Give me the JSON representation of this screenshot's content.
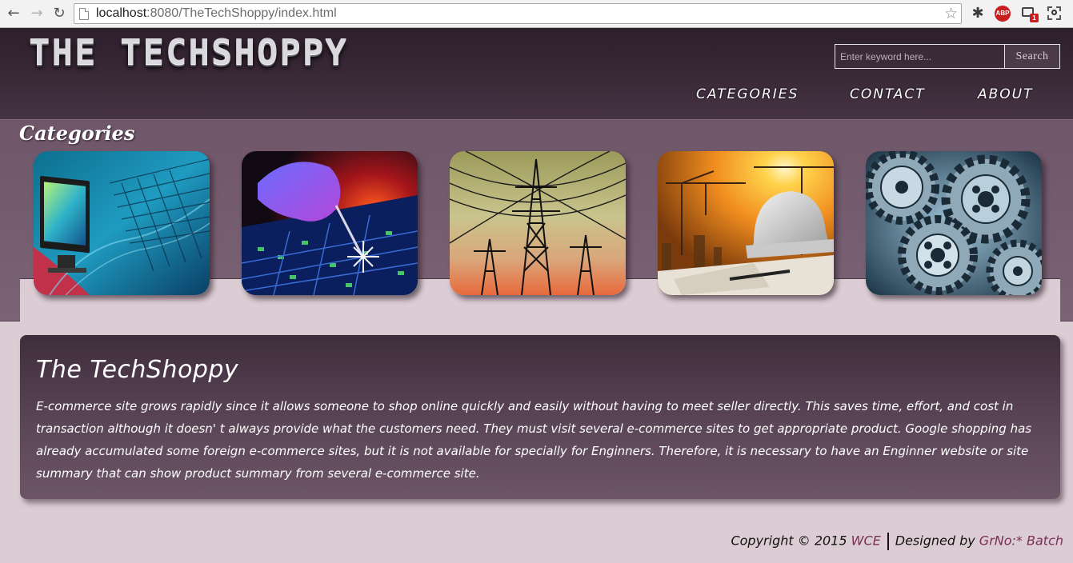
{
  "browser": {
    "url_host": "localhost",
    "url_rest": ":8080/TheTechShoppy/index.html",
    "icons": [
      "back-icon",
      "forward-icon",
      "reload-icon",
      "page-icon",
      "bookmark-star-icon",
      "bug-extension-icon",
      "adblock-icon",
      "cast-extension-icon",
      "screenshot-extension-icon"
    ],
    "abp_label": "ABP",
    "cast_badge": "1"
  },
  "header": {
    "logo": "THE TECHSHOPPY",
    "search": {
      "placeholder": "Enter keyword here...",
      "button_label": "Search"
    },
    "nav": [
      "CATEGORIES",
      "CONTACT",
      "ABOUT"
    ]
  },
  "categories": {
    "title": "Categories",
    "tiles": [
      {
        "image": "computer-monitor-keyboard"
      },
      {
        "image": "circuit-board-probe"
      },
      {
        "image": "electricity-pylons"
      },
      {
        "image": "construction-cranes-helmet"
      },
      {
        "image": "mechanical-gears"
      }
    ]
  },
  "main": {
    "title": "The TechShoppy",
    "body": "E-commerce site grows rapidly since it allows someone to shop online quickly and easily without having to meet seller directly. This saves time, effort, and cost in transaction although it doesn' t always provide what the customers need. They must visit several e-commerce sites to get appropriate product. Google shopping has already accumulated some foreign e-commerce sites, but it is not available for specially for Enginners. Therefore, it is necessary to have an Enginner website or site summary that can show product summary from several e-commerce site."
  },
  "footer": {
    "copyright": "Copyright © 2015",
    "org": "WCE",
    "designed_by": "Designed by",
    "designer": "GrNo:* Batch"
  },
  "colors": {
    "header_bg": "#3b2a38",
    "band_bg": "#755d70",
    "page_bg": "#dccdd4",
    "footer_accent": "#7a2f55"
  }
}
